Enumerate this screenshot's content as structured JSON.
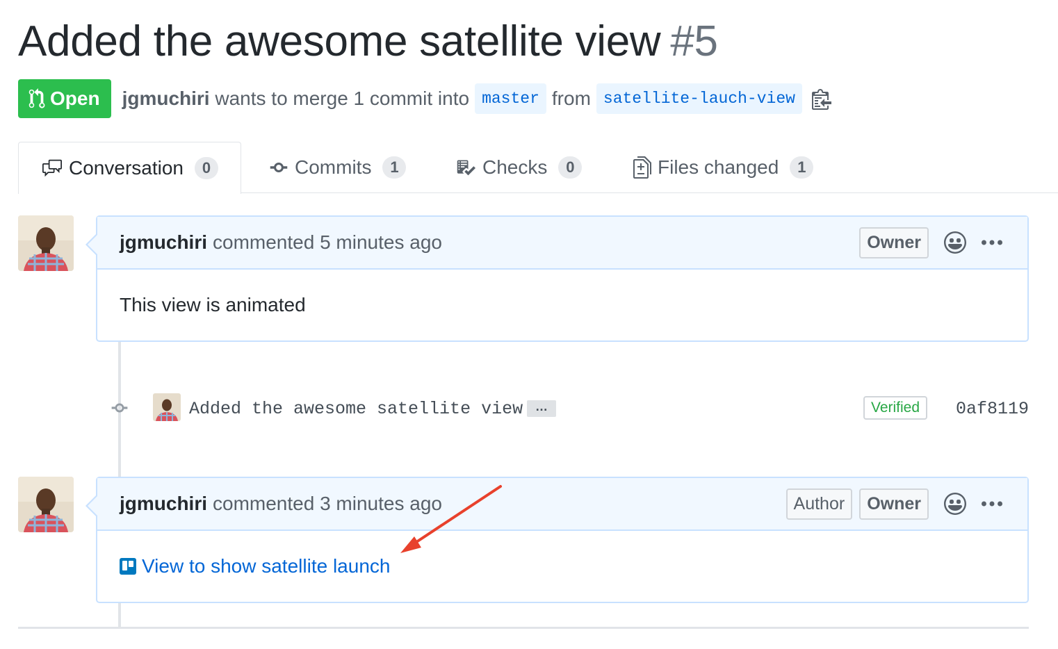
{
  "pr": {
    "title": "Added the awesome satellite view",
    "number": "#5",
    "state": "Open",
    "author": "jgmuchiri",
    "merge_text": "wants to merge 1 commit into",
    "base_branch": "master",
    "from_text": "from",
    "head_branch": "satellite-lauch-view"
  },
  "tabs": [
    {
      "label": "Conversation",
      "count": "0",
      "icon": "comment-discussion-icon"
    },
    {
      "label": "Commits",
      "count": "1",
      "icon": "git-commit-icon"
    },
    {
      "label": "Checks",
      "count": "0",
      "icon": "checklist-icon"
    },
    {
      "label": "Files changed",
      "count": "1",
      "icon": "file-diff-icon"
    }
  ],
  "comments": [
    {
      "author": "jgmuchiri",
      "meta": "commented 5 minutes ago",
      "labels": [
        "Owner"
      ],
      "body": "This view is animated"
    },
    {
      "author": "jgmuchiri",
      "meta": "commented 3 minutes ago",
      "labels": [
        "Author",
        "Owner"
      ],
      "link_text": "View to show satellite launch"
    }
  ],
  "commit": {
    "message": "Added the awesome satellite view",
    "expand": "…",
    "verified": "Verified",
    "sha": "0af8119"
  },
  "colors": {
    "open_green": "#2cbe4e",
    "link_blue": "#0366d6",
    "header_bg": "#f1f8ff",
    "header_border": "#c8e1ff",
    "arrow_red": "#e8412c",
    "verified_green": "#28a745"
  }
}
